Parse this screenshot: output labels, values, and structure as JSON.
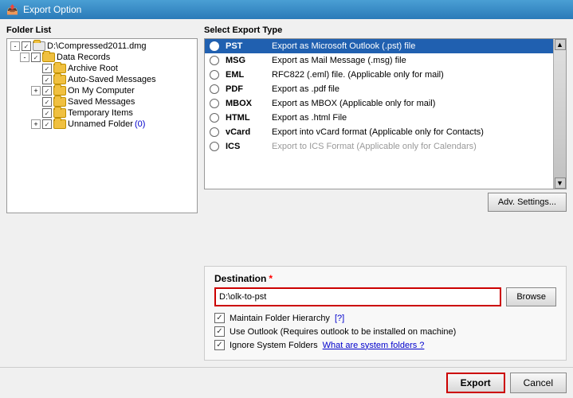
{
  "titleBar": {
    "icon": "📤",
    "title": "Export Option"
  },
  "leftPanel": {
    "label": "Folder List",
    "tree": [
      {
        "id": "drive",
        "indent": 0,
        "expander": "-",
        "checkbox": "✓",
        "text": "D:\\Compressed2011.dmg",
        "level": 0
      },
      {
        "id": "datarecords",
        "indent": 1,
        "expander": "-",
        "checkbox": "✓",
        "text": "Data Records",
        "level": 1
      },
      {
        "id": "archiveroot",
        "indent": 2,
        "expander": null,
        "checkbox": "✓",
        "text": "Archive Root",
        "level": 2
      },
      {
        "id": "autosaved",
        "indent": 2,
        "expander": null,
        "checkbox": "✓",
        "text": "Auto-Saved Messages",
        "level": 2
      },
      {
        "id": "onmycomputer",
        "indent": 2,
        "expander": "+",
        "checkbox": "✓",
        "text": "On My Computer",
        "level": 2
      },
      {
        "id": "savedmessages",
        "indent": 2,
        "expander": null,
        "checkbox": "✓",
        "text": "Saved Messages",
        "level": 2
      },
      {
        "id": "tempitems",
        "indent": 2,
        "expander": null,
        "checkbox": "✓",
        "text": "Temporary Items",
        "level": 2
      },
      {
        "id": "unnamed",
        "indent": 2,
        "expander": "+",
        "checkbox": "✓",
        "text": "Unnamed Folder",
        "blue_text": " (0)",
        "level": 2
      }
    ]
  },
  "rightPanel": {
    "label": "Select Export Type",
    "exportTypes": [
      {
        "id": "pst",
        "name": "PST",
        "desc": "Export as Microsoft Outlook (.pst) file",
        "selected": true
      },
      {
        "id": "msg",
        "name": "MSG",
        "desc": "Export as Mail Message (.msg) file",
        "selected": false
      },
      {
        "id": "eml",
        "name": "EML",
        "desc": "RFC822 (.eml) file. (Applicable only for mail)",
        "selected": false
      },
      {
        "id": "pdf",
        "name": "PDF",
        "desc": "Export as .pdf file",
        "selected": false
      },
      {
        "id": "mbox",
        "name": "MBOX",
        "desc": "Export as MBOX (Applicable only for mail)",
        "selected": false
      },
      {
        "id": "html",
        "name": "HTML",
        "desc": "Export as .html File",
        "selected": false
      },
      {
        "id": "vcard",
        "name": "vCard",
        "desc": "Export into vCard format (Applicable only for Contacts)",
        "selected": false
      },
      {
        "id": "ics",
        "name": "ICS",
        "desc": "Export to ICS Format (Applicable only for Calendars)",
        "selected": false
      }
    ],
    "advButton": "Adv. Settings...",
    "destination": {
      "label": "Destination",
      "required": "*",
      "value": "D:\\olk-to-pst",
      "placeholder": "",
      "browseLabel": "Browse"
    },
    "options": [
      {
        "id": "hierarchy",
        "checked": true,
        "label": "Maintain Folder Hierarchy",
        "help": "[?]",
        "hasHelp": true
      },
      {
        "id": "useoutlook",
        "checked": true,
        "label": "Use Outlook (Requires outlook to be installed on machine)",
        "hasHelp": false
      },
      {
        "id": "ignoresystem",
        "checked": true,
        "label": "Ignore System Folders",
        "helpLink": "What are system folders ?",
        "hasHelp": true
      }
    ]
  },
  "footer": {
    "exportLabel": "Export",
    "cancelLabel": "Cancel"
  }
}
